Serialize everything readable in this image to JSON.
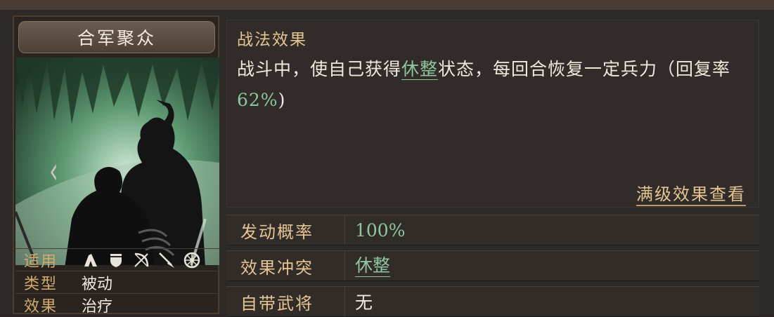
{
  "tactic": {
    "name": "合军聚众",
    "meta": [
      {
        "label": "适用",
        "icons": [
          "cavalry-icon",
          "shield-icon",
          "bow-icon",
          "spear-icon",
          "wheel-icon"
        ]
      },
      {
        "label": "类型",
        "value": "被动"
      },
      {
        "label": "效果",
        "value": "治疗"
      }
    ]
  },
  "effect": {
    "title": "战法效果",
    "desc_prefix": "战斗中，使自己获得",
    "desc_keyword": "休整",
    "desc_middle": "状态，每回合恢复一定兵力（回复率",
    "desc_rate": "62%",
    "desc_suffix": ")",
    "more_link": "满级效果查看"
  },
  "details": [
    {
      "label": "发动概率",
      "value": "100%"
    },
    {
      "label": "效果冲突",
      "value": "休整"
    },
    {
      "label": "自带武将",
      "value": "无"
    }
  ],
  "colors": {
    "accent_gold": "#e5c493",
    "accent_green": "#8fc6a0",
    "panel_bg": "#312c29"
  }
}
